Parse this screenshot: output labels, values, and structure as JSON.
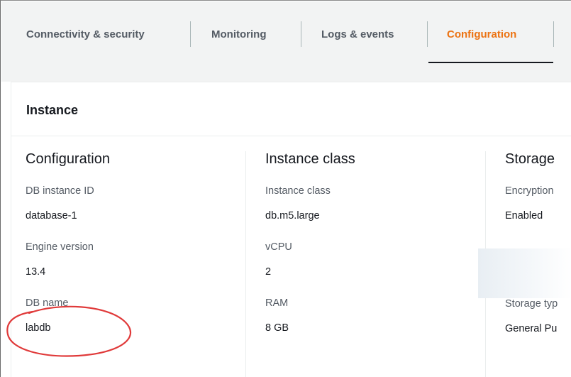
{
  "tabs": [
    {
      "label": "Connectivity & security",
      "active": false
    },
    {
      "label": "Monitoring",
      "active": false
    },
    {
      "label": "Logs & events",
      "active": false
    },
    {
      "label": "Configuration",
      "active": true
    }
  ],
  "panel": {
    "title": "Instance"
  },
  "columns": [
    {
      "title": "Configuration",
      "fields": [
        {
          "label": "DB instance ID",
          "value": "database-1"
        },
        {
          "label": "Engine version",
          "value": "13.4"
        },
        {
          "label": "DB name",
          "value": "labdb"
        }
      ]
    },
    {
      "title": "Instance class",
      "fields": [
        {
          "label": "Instance class",
          "value": "db.m5.large"
        },
        {
          "label": "vCPU",
          "value": "2"
        },
        {
          "label": "RAM",
          "value": "8 GB"
        }
      ]
    },
    {
      "title": "Storage",
      "fields": [
        {
          "label": "Encryption",
          "value": "Enabled"
        },
        {
          "label": "Storage typ",
          "value": "General Pu"
        }
      ]
    }
  ],
  "colors": {
    "active_tab": "#ec7211",
    "annotation": "#e03a3a"
  }
}
